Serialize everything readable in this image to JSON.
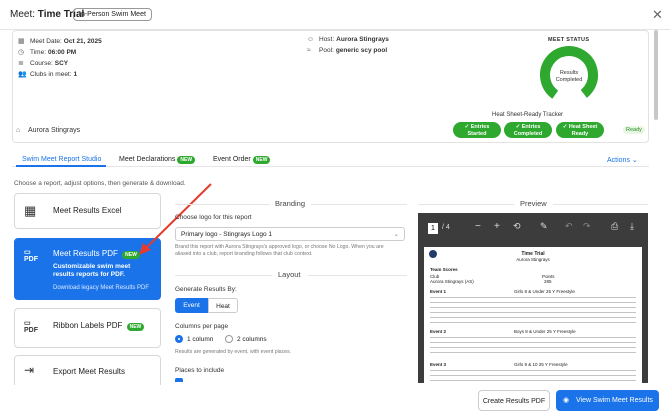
{
  "header": {
    "prefix": "Meet:",
    "title": "Time Trial",
    "chip": "In-Person Swim Meet"
  },
  "meet": {
    "date_label": "Meet Date:",
    "date": "Oct 21, 2025",
    "time_label": "Time:",
    "time": "06:00 PM",
    "course_label": "Course:",
    "course": "SCY",
    "clubs_label": "Clubs in meet:",
    "clubs": "1",
    "host_label": "Host:",
    "host": "Aurora Stingrays",
    "pool_label": "Pool:",
    "pool": "generic scy pool",
    "club_name": "Aurora Stingrays"
  },
  "status": {
    "title": "MEET STATUS",
    "gauge_text": "Results\nCompleted",
    "gauge_l1": "Results",
    "gauge_l2": "Completed",
    "accent": "#2ea82e"
  },
  "tracker": {
    "title": "Heat Sheet-Ready Tracker",
    "steps": [
      {
        "l1": "✓ Entries",
        "l2": "Started"
      },
      {
        "l1": "✓ Entries",
        "l2": "Completed"
      },
      {
        "l1": "✓ Heat Sheet",
        "l2": "Ready"
      }
    ],
    "badge": "Ready"
  },
  "tabs": [
    {
      "label": "Swim Meet Report Studio"
    },
    {
      "label": "Meet Declarations",
      "badge": "NEW"
    },
    {
      "label": "Event Order",
      "badge": "NEW"
    }
  ],
  "actions": "Actions",
  "subtitle": "Choose a report, adjust options, then generate & download.",
  "reports": [
    {
      "title": "Meet Results Excel"
    },
    {
      "title": "Meet Results PDF",
      "badge": "NEW",
      "desc1": "Customizable swim meet",
      "desc2": "results reports for PDF.",
      "link": "Download legacy Meet Results PDF"
    },
    {
      "title": "Ribbon Labels PDF",
      "badge": "NEW"
    },
    {
      "title": "Export Meet Results"
    }
  ],
  "branding": {
    "title": "Branding",
    "logo_label": "Choose logo for this report",
    "logo_value": "Primary logo - Stingrays Logo 1",
    "help1": "Brand this report with Aurora Stingrays's approved logo, or choose No Logo. When you are",
    "help2": "aliased into a club, report branding follows that club context."
  },
  "layout": {
    "title": "Layout",
    "gen_label": "Generate Results By:",
    "opt_event": "Event",
    "opt_heat": "Heat",
    "cols_label": "Columns per page",
    "col1": "1 column",
    "col2": "2 columns",
    "cols_help": "Results are generated by event, with event places.",
    "places_label": "Places to include"
  },
  "preview": {
    "title": "Preview",
    "page": "1",
    "of": "/ 4",
    "doc_title": "Time Trial",
    "doc_sub": "Aurora Stingrays",
    "team_scores": "Team Scores",
    "club_h": "Club",
    "points_h": "Points",
    "club_row": "Aurora Stingrays (AS)",
    "points_row": "285",
    "e1": "Event 1",
    "e1t": "Girls 8 & Under 25 Y Freestyle",
    "e2": "Event 2",
    "e2t": "Boys 8 & Under 25 Y Freestyle",
    "e3": "Event 3",
    "e3t": "Girls 9 & 10 25 Y Freestyle",
    "cols": [
      "Place",
      "Heat",
      "Lane",
      "Name",
      "Age",
      "Club",
      "Time",
      "Pts"
    ]
  },
  "footer": {
    "create": "Create Results PDF",
    "view": "View Swim Meet Results"
  }
}
